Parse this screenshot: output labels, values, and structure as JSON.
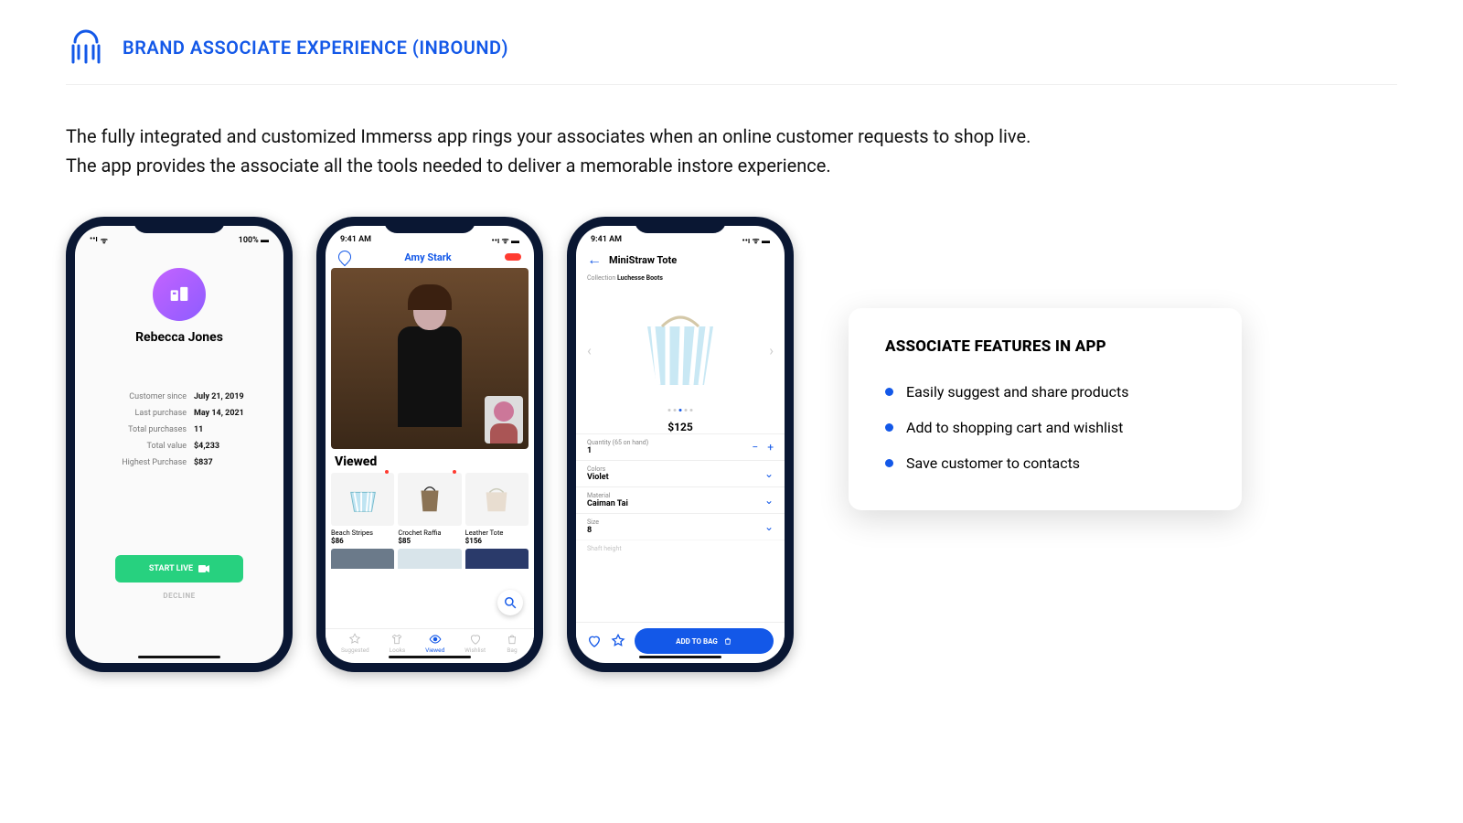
{
  "header": {
    "title": "BRAND ASSOCIATE EXPERIENCE (INBOUND)"
  },
  "intro": {
    "line1": "The fully integrated and customized Immerss app rings your associates when an online customer requests to shop live.",
    "line2": "The app provides the associate all the tools needed to deliver a memorable instore experience."
  },
  "phone1": {
    "status_left": "••• ⋮",
    "status_right": "100%",
    "customer_name": "Rebecca Jones",
    "stats": [
      {
        "k": "Customer since",
        "v": "July 21, 2019"
      },
      {
        "k": "Last purchase",
        "v": "May 14, 2021"
      },
      {
        "k": "Total purchases",
        "v": "11"
      },
      {
        "k": "Total value",
        "v": "$4,233"
      },
      {
        "k": "Highest Purchase",
        "v": "$837"
      }
    ],
    "start_label": "START LIVE",
    "decline_label": "DECLINE"
  },
  "phone2": {
    "time": "9:41 AM",
    "caller_name": "Amy Stark",
    "viewed_label": "Viewed",
    "products": [
      {
        "name": "Beach Stripes",
        "price": "$86"
      },
      {
        "name": "Crochet Raffia",
        "price": "$85"
      },
      {
        "name": "Leather Tote",
        "price": "$156"
      }
    ],
    "tabs": [
      "Suggested",
      "Looks",
      "Viewed",
      "Wishlist",
      "Bag"
    ],
    "active_tab": 2
  },
  "phone3": {
    "time": "9:41 AM",
    "title": "MiniStraw Tote",
    "collection_label": "Collection",
    "collection_name": "Luchesse Boots",
    "price": "$125",
    "options": [
      {
        "label": "Quantity (65 on hand)",
        "value": "1",
        "type": "stepper"
      },
      {
        "label": "Colors",
        "value": "Violet",
        "type": "select"
      },
      {
        "label": "Material",
        "value": "Caiman Tai",
        "type": "select"
      },
      {
        "label": "Size",
        "value": "8",
        "type": "select"
      },
      {
        "label": "Shaft height",
        "value": "",
        "type": "select"
      }
    ],
    "add_to_bag": "ADD TO BAG"
  },
  "features": {
    "heading": "ASSOCIATE FEATURES IN APP",
    "items": [
      "Easily suggest and share products",
      "Add to shopping cart and wishlist",
      "Save customer to contacts"
    ]
  }
}
